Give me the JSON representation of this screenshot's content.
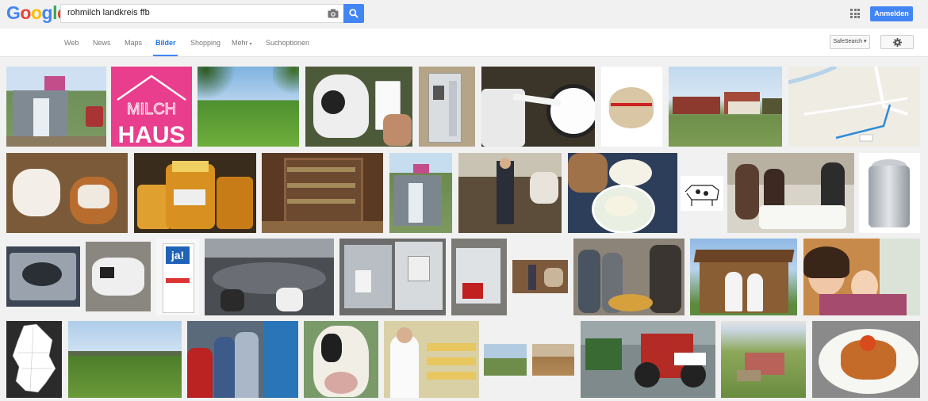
{
  "logo": [
    "G",
    "o",
    "o",
    "g",
    "l",
    "e"
  ],
  "logo_colors": [
    "#4285f4",
    "#ea4335",
    "#fbbc05",
    "#4285f4",
    "#34a853",
    "#ea4335"
  ],
  "search": {
    "value": "rohmilch landkreis ffb",
    "camera_icon": "camera-icon",
    "button_icon": "search-icon"
  },
  "header": {
    "apps_icon": "apps-grid-icon",
    "login_label": "Anmelden"
  },
  "nav": [
    {
      "label": "Web"
    },
    {
      "label": "News"
    },
    {
      "label": "Maps"
    },
    {
      "label": "Bilder"
    },
    {
      "label": "Shopping"
    },
    {
      "label": "Mehr"
    },
    {
      "label": "Suchoptionen"
    }
  ],
  "safesearch": {
    "label": "SafeSearch"
  },
  "settings": {
    "icon": "gear-icon"
  },
  "colors": {
    "accent": "#4285f4",
    "active_nav": "#1a73e8",
    "background": "#f1f1f1"
  },
  "results": [
    {
      "name": "milchhaus-kiosk"
    },
    {
      "name": "milch-haus-logo",
      "text": "MILCH HAUS"
    },
    {
      "name": "meadow-cows"
    },
    {
      "name": "cow-milk-glass"
    },
    {
      "name": "milk-vending-machine"
    },
    {
      "name": "milk-pouring"
    },
    {
      "name": "cheese-wheel"
    },
    {
      "name": "farm-buildings"
    },
    {
      "name": "map-route"
    },
    {
      "name": "calves"
    },
    {
      "name": "honey-jars"
    },
    {
      "name": "shop-shelves"
    },
    {
      "name": "milchhaus-hut"
    },
    {
      "name": "farmer-barn"
    },
    {
      "name": "milk-soup-plate"
    },
    {
      "name": "cow-drawing"
    },
    {
      "name": "people-dining"
    },
    {
      "name": "milk-can"
    },
    {
      "name": "milking-machine"
    },
    {
      "name": "cow-stable"
    },
    {
      "name": "milk-carton",
      "text": "ja!"
    },
    {
      "name": "milking-carousel"
    },
    {
      "name": "milk-dispenser"
    },
    {
      "name": "milk-machine-room"
    },
    {
      "name": "stable-interior"
    },
    {
      "name": "cooking-men"
    },
    {
      "name": "wooden-milk-hut"
    },
    {
      "name": "woman-child"
    },
    {
      "name": "germany-map"
    },
    {
      "name": "landscape-field"
    },
    {
      "name": "family-vending"
    },
    {
      "name": "cow-closeup"
    },
    {
      "name": "cheese-maker"
    },
    {
      "name": "field-small-1"
    },
    {
      "name": "field-small-2"
    },
    {
      "name": "tractors"
    },
    {
      "name": "aerial-farm"
    },
    {
      "name": "food-plate"
    }
  ]
}
